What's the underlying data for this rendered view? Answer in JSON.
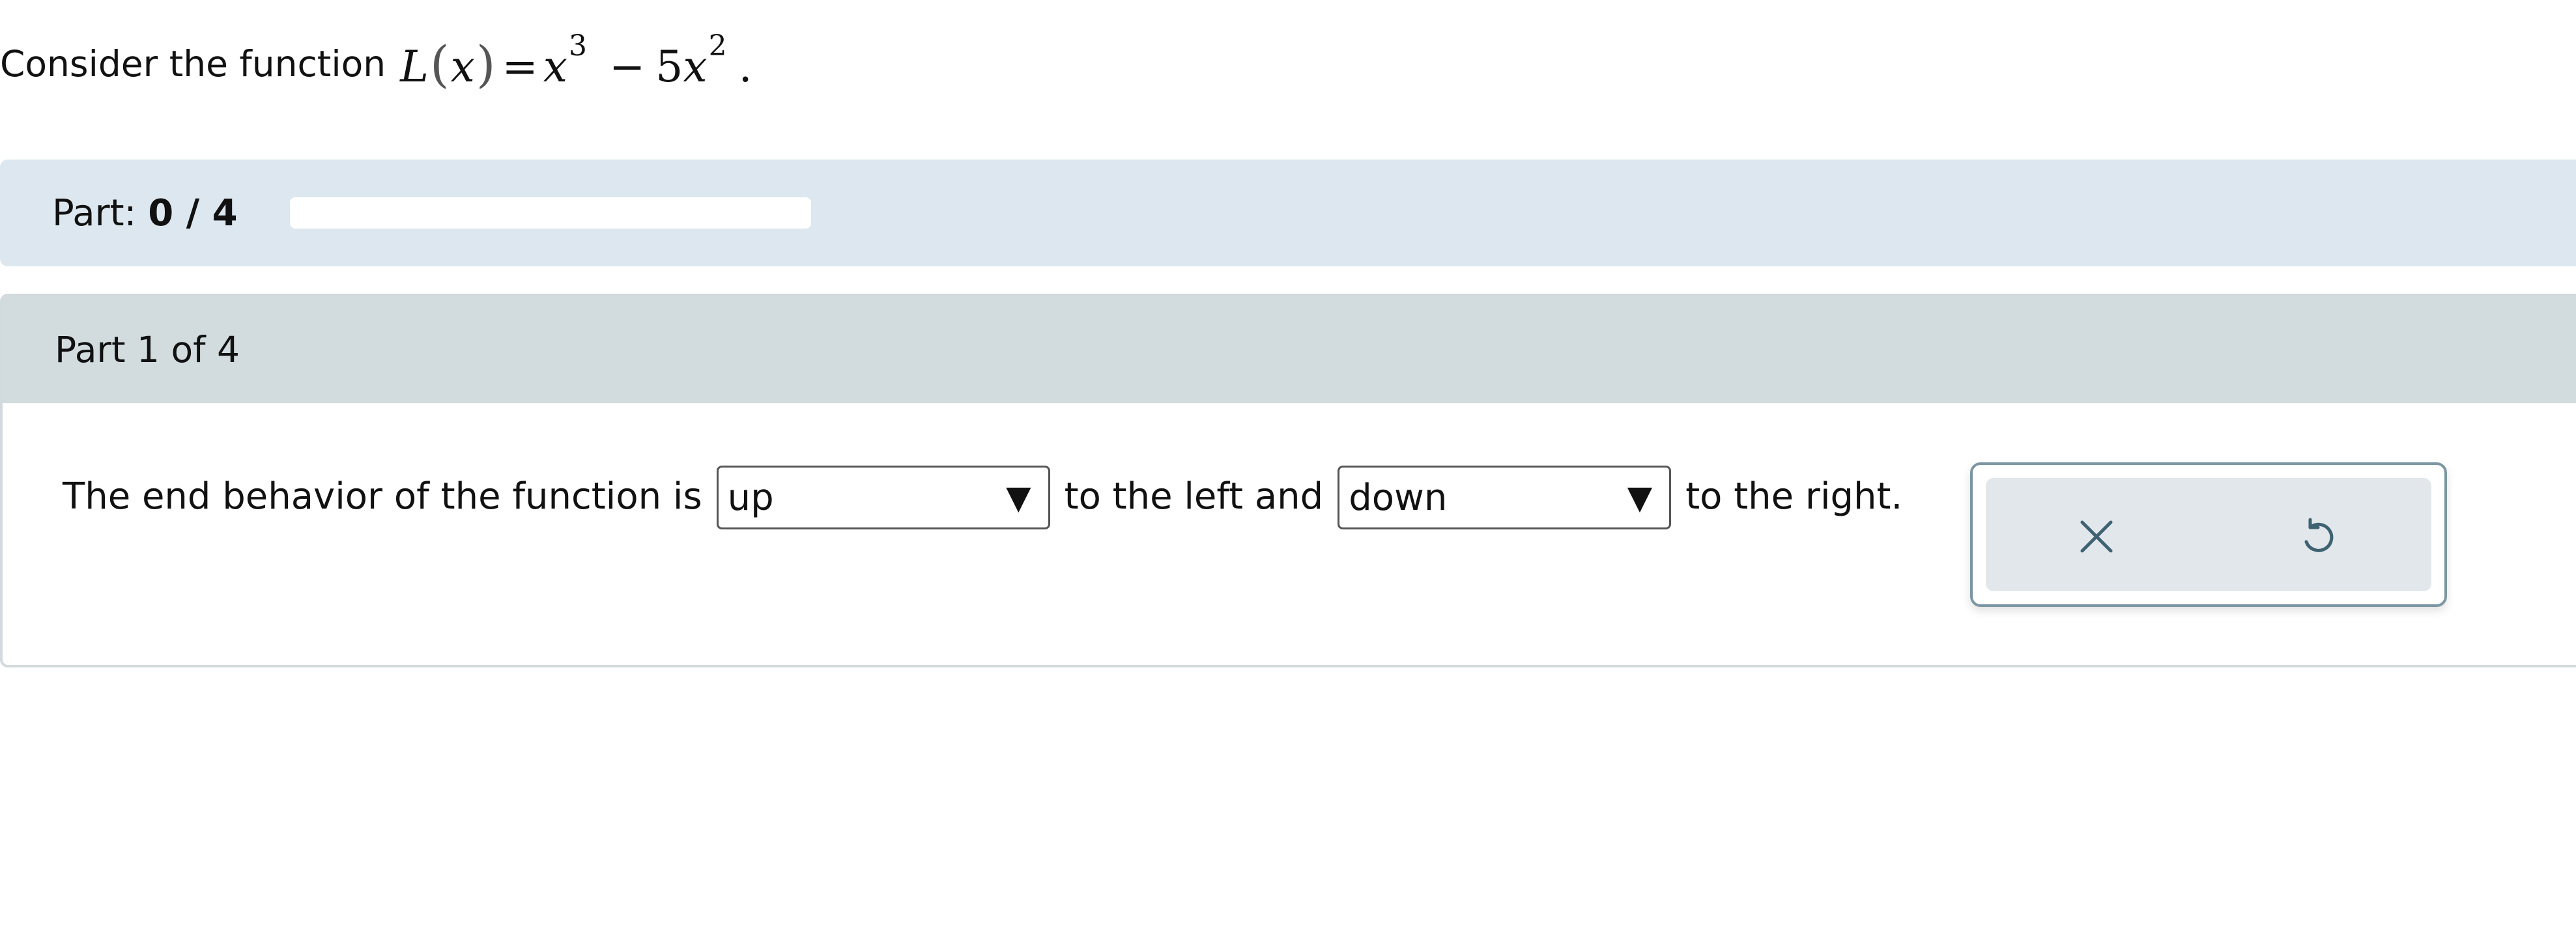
{
  "question": {
    "prefix": "Consider the function",
    "math": {
      "fn_name": "L",
      "open_paren": "(",
      "var": "x",
      "close_paren": ")",
      "equals": "=",
      "term1_var": "x",
      "term1_exp": "3",
      "minus": "−",
      "term2_coef": "5",
      "term2_var": "x",
      "term2_exp": "2",
      "period": "."
    }
  },
  "progress": {
    "label": "Part:",
    "value_text": "0 / 4",
    "completed": 0,
    "total": 4
  },
  "part": {
    "header": "Part 1 of 4",
    "sentence_start": "The end behavior of the function is",
    "dropdown_left": {
      "selected": "up",
      "caret": "▼"
    },
    "sentence_middle": "to the left and",
    "dropdown_right": {
      "selected": "down",
      "caret": "▼"
    },
    "sentence_end": "to the right."
  },
  "tools": {
    "clear_icon": "close-icon",
    "undo_icon": "undo-icon",
    "icon_color": "#3e6272"
  },
  "colors": {
    "progress_panel": "#dce7ef",
    "part_header": "#d2dcdf",
    "tool_border": "#7c97a3",
    "tool_inner": "#e1e7ea"
  }
}
